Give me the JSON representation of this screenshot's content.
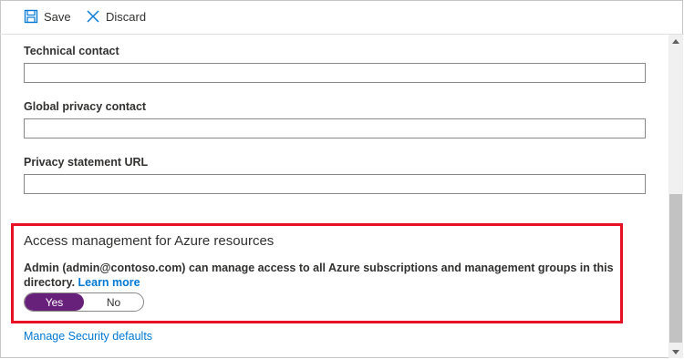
{
  "toolbar": {
    "save_label": "Save",
    "discard_label": "Discard"
  },
  "fields": {
    "technical_contact": {
      "label": "Technical contact",
      "value": ""
    },
    "global_privacy_contact": {
      "label": "Global privacy contact",
      "value": ""
    },
    "privacy_statement_url": {
      "label": "Privacy statement URL",
      "value": ""
    }
  },
  "access_management": {
    "title": "Access management for Azure resources",
    "description": "Admin (admin@contoso.com) can manage access to all Azure subscriptions and management groups in this directory.",
    "learn_more": "Learn more",
    "toggle": {
      "yes": "Yes",
      "no": "No",
      "selected": "Yes"
    }
  },
  "links": {
    "manage_security_defaults": "Manage Security defaults"
  },
  "colors": {
    "accent": "#0078d4",
    "toggle_on": "#68217a",
    "highlight": "#e81123"
  },
  "icons": {
    "save": "save-icon",
    "discard": "close-icon"
  }
}
